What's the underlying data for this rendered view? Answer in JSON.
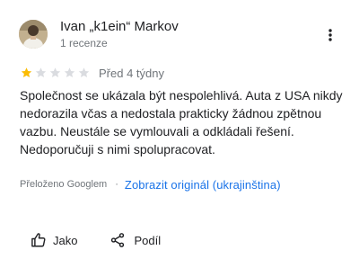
{
  "review": {
    "author": {
      "name": "Ivan „k1ein“ Markov",
      "meta": "1 recenze"
    },
    "rating": {
      "filled": 1,
      "total": 5,
      "filled_color": "#fbbc04",
      "empty_color": "#dadce0"
    },
    "date": "Před 4 týdny",
    "text": "Společnost se ukázala být nespolehlivá. Auta z USA nikdy nedorazila včas a nedostala prakticky žádnou zpětnou vazbu. Neustále se vymlouvali a odkládali řešení. Nedoporučuji s nimi spolupracovat.",
    "translation": {
      "note": "Přeloženo Googlem",
      "separator": "·",
      "show_original": "Zobrazit originál (ukrajinština)"
    },
    "actions": {
      "like": "Jako",
      "share": "Podíl"
    },
    "icons": {
      "more": "more-vert-icon",
      "like": "thumb-up-icon",
      "share": "share-icon"
    },
    "colors": {
      "link": "#1a73e8",
      "secondary_text": "#70757a"
    }
  }
}
